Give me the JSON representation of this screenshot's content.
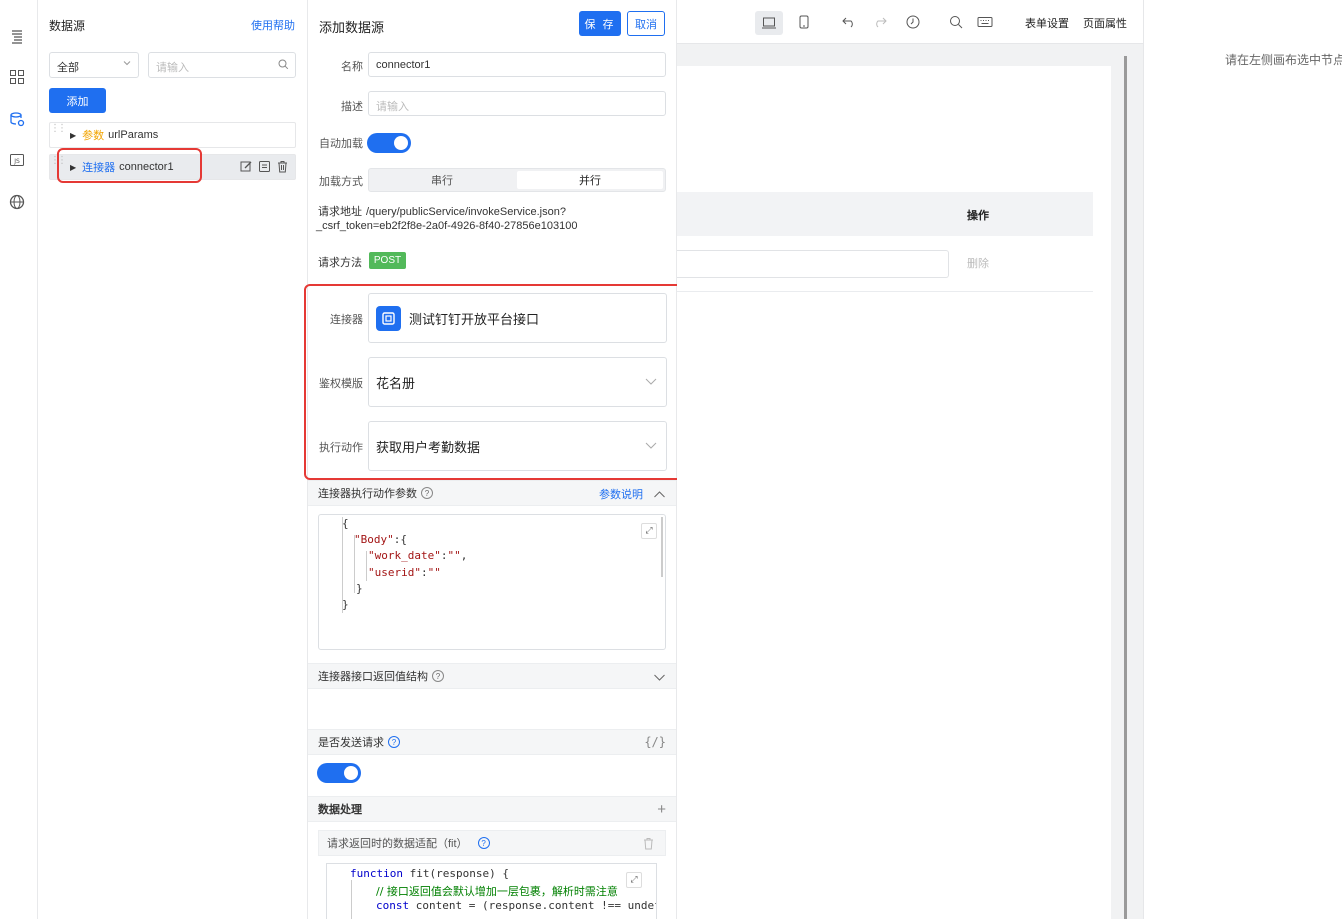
{
  "left_rail": {
    "icons": [
      "outline-icon",
      "components-icon",
      "datasource-icon",
      "js-icon",
      "globe-icon"
    ]
  },
  "datasource_panel": {
    "title": "数据源",
    "help_link": "使用帮助",
    "filter_value": "全部",
    "search_placeholder": "请输入",
    "add_button": "添加",
    "items": [
      {
        "tag": "参数",
        "name": "urlParams"
      },
      {
        "tag": "连接器",
        "name": "connector1"
      }
    ]
  },
  "config_panel": {
    "title": "添加数据源",
    "save_button": "保 存",
    "cancel_button": "取消",
    "name_label": "名称",
    "name_value": "connector1",
    "desc_label": "描述",
    "desc_placeholder": "请输入",
    "autoload_label": "自动加载",
    "autoload_on": true,
    "load_mode_label": "加载方式",
    "load_mode_options": [
      "串行",
      "并行"
    ],
    "load_mode_selected": "并行",
    "url_label": "请求地址",
    "url_value": "/query/publicService/invokeService.json?_csrf_token=eb2f2f8e-2a0f-4926-8f40-27856e103100",
    "method_label": "请求方法",
    "method_value": "POST",
    "connector_label": "连接器",
    "connector_value": "测试钉钉开放平台接口",
    "auth_label": "鉴权模版",
    "auth_value": "花名册",
    "action_label": "执行动作",
    "action_value": "获取用户考勤数据",
    "params_section": "连接器执行动作参数",
    "params_help": "参数说明",
    "params_code": {
      "line1": "{",
      "line2_key": "\"Body\"",
      "line2_rest": ":{",
      "line3_key": "\"work_date\"",
      "line3_rest": ":",
      "line3_val": "\"\"",
      "line3_end": ",",
      "line4_key": "\"userid\"",
      "line4_rest": ":",
      "line4_val": "\"\"",
      "line5": "}",
      "line6": "}"
    },
    "return_section": "连接器接口返回值结构",
    "send_section": "是否发送请求",
    "send_code_icon": "{/}",
    "send_on": true,
    "processing_section": "数据处理",
    "fit_label": "请求返回时的数据适配（fit）",
    "fit_code": {
      "line1_kw": "function",
      "line1_rest": " fit(response) {",
      "line2": "// 接口返回值会默认增加一层包裹，解析时需注意",
      "line3_kw": "const",
      "line3_rest": " content = (response.content !== undef"
    }
  },
  "canvas": {
    "toolbar_form_settings": "表单设置",
    "toolbar_page_props": "页面属性",
    "table_header_action": "操作",
    "row_delete": "删除"
  },
  "right_panel": {
    "hint": "请在左侧画布选中节点"
  },
  "colors": {
    "primary": "#1f6ff0",
    "highlight": "#e53935",
    "post": "#52b95a"
  }
}
